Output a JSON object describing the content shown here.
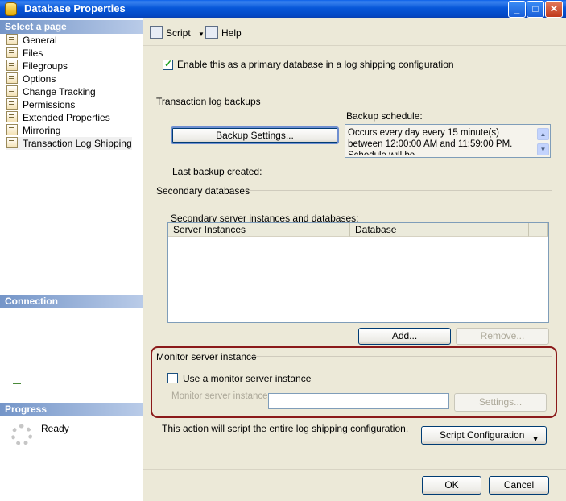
{
  "window": {
    "title": "Database Properties",
    "controls": {
      "minimize": "_",
      "maximize": "□",
      "close": "✕"
    }
  },
  "left": {
    "select_page_header": "Select a page",
    "pages": [
      {
        "label": "General"
      },
      {
        "label": "Files"
      },
      {
        "label": "Filegroups"
      },
      {
        "label": "Options"
      },
      {
        "label": "Change Tracking"
      },
      {
        "label": "Permissions"
      },
      {
        "label": "Extended Properties"
      },
      {
        "label": "Mirroring"
      },
      {
        "label": "Transaction Log Shipping"
      }
    ],
    "connection_header": "Connection",
    "progress_header": "Progress",
    "progress_status": "Ready"
  },
  "toolbar": {
    "script_label": "Script",
    "script_arrow": "▼",
    "help_label": "Help"
  },
  "main": {
    "enable_primary_label": "Enable this as a primary database in a log shipping configuration",
    "enable_primary_checked": true,
    "txlog_group_label": "Transaction log backups",
    "backup_settings_button": "Backup Settings...",
    "backup_schedule_label": "Backup schedule:",
    "backup_schedule_text": "Occurs every day every 15 minute(s) between 12:00:00 AM and 11:59:00 PM. Schedule will be",
    "last_backup_label": "Last backup created:",
    "secondary_group_label": "Secondary databases",
    "secondary_list_label": "Secondary server instances and databases:",
    "columns": [
      "Server Instances",
      "Database"
    ],
    "add_button": "Add...",
    "remove_button": "Remove...",
    "monitor_group_label": "Monitor server instance",
    "use_monitor_label": "Use a monitor server instance",
    "use_monitor_checked": false,
    "monitor_instance_label": "Monitor server instance",
    "monitor_instance_value": "",
    "settings_button": "Settings...",
    "script_note": "This action will script the entire log shipping configuration.",
    "script_config_button": "Script Configuration",
    "script_config_arrow": "▼"
  },
  "footer": {
    "ok_button": "OK",
    "cancel_button": "Cancel"
  },
  "colors": {
    "titlebar": "#0757d9",
    "panel_header": "#7495c8",
    "highlight_box": "#8b1a1a"
  }
}
